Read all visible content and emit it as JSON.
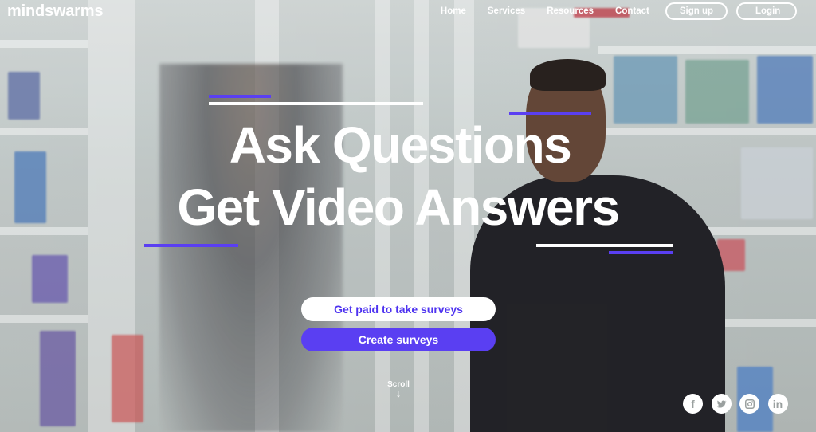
{
  "brand": {
    "logo_text": "mindswarms"
  },
  "nav": {
    "items": [
      {
        "label": "Home"
      },
      {
        "label": "Services"
      },
      {
        "label": "Resources"
      },
      {
        "label": "Contact"
      }
    ],
    "signup_label": "Sign up",
    "login_label": "Login"
  },
  "hero": {
    "headline_line1": "Ask Questions",
    "headline_line2": "Get Video Answers",
    "cta_take_surveys": "Get paid to take surveys",
    "cta_create_surveys": "Create surveys",
    "scroll_label": "Scroll",
    "scroll_arrow": "↓"
  },
  "social": [
    {
      "name": "facebook",
      "glyph": "f"
    },
    {
      "name": "twitter",
      "glyph": ""
    },
    {
      "name": "instagram",
      "glyph": ""
    },
    {
      "name": "linkedin",
      "glyph": "in"
    }
  ],
  "colors": {
    "accent": "#5a3ff2",
    "text_on_hero": "#ffffff"
  }
}
